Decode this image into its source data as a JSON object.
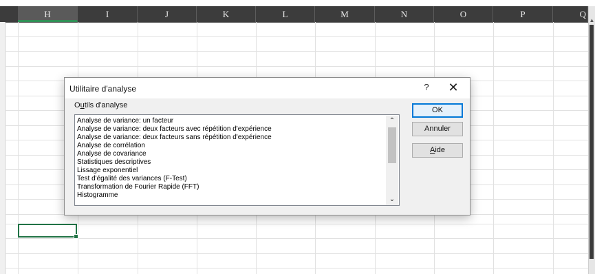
{
  "spreadsheet": {
    "columns": [
      "H",
      "I",
      "J",
      "K",
      "L",
      "M",
      "N",
      "O",
      "P",
      "Q"
    ],
    "selected_column": "H"
  },
  "dialog": {
    "title": "Utilitaire d'analyse",
    "help_glyph": "?",
    "close_glyph": "✕",
    "group_label": "Outils d'analyse",
    "group_label_accel": "u",
    "list_items": [
      "Analyse de variance: un facteur",
      "Analyse de variance: deux facteurs avec répétition d'expérience",
      "Analyse de variance: deux facteurs sans répétition d'expérience",
      "Analyse de corrélation",
      "Analyse de covariance",
      "Statistiques descriptives",
      "Lissage exponentiel",
      "Test d'égalité des variances (F-Test)",
      "Transformation de Fourier Rapide (FFT)",
      "Histogramme"
    ],
    "buttons": {
      "ok": "OK",
      "cancel": "Annuler",
      "help": "Aide",
      "help_accel": "A"
    }
  },
  "icons": {
    "scroll_up": "chevron-up-icon",
    "scroll_down": "chevron-down-icon",
    "close": "close-icon",
    "help": "question-icon"
  },
  "colors": {
    "header_bg": "#3c3c3c",
    "selection_green": "#217346",
    "default_button_border": "#0078d7",
    "dialog_bg": "#f0f0f0"
  }
}
